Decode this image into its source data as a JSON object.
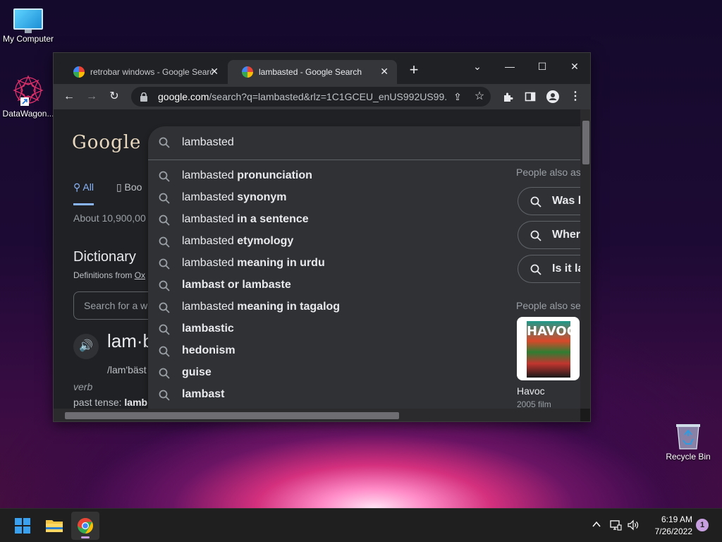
{
  "desktop": {
    "icons": [
      {
        "label": "My Computer"
      },
      {
        "label": "DataWagon..."
      },
      {
        "label": "Recycle Bin"
      }
    ]
  },
  "browser": {
    "tabs": [
      {
        "title": "retrobar windows - Google Search",
        "active": false
      },
      {
        "title": "lambasted - Google Search",
        "active": true
      }
    ],
    "url_host": "google.com",
    "url_rest": "/search?q=lambasted&rlz=1C1GCEU_enUS992US99..."
  },
  "search": {
    "query": "lambasted",
    "suggestions": [
      {
        "prefix": "lambasted ",
        "bold": "pronunciation"
      },
      {
        "prefix": "lambasted ",
        "bold": "synonym"
      },
      {
        "prefix": "lambasted ",
        "bold": "in a sentence"
      },
      {
        "prefix": "lambasted ",
        "bold": "etymology"
      },
      {
        "prefix": "lambasted ",
        "bold": "meaning in urdu"
      },
      {
        "prefix": "",
        "bold": "lambast or lambaste"
      },
      {
        "prefix": "lambasted ",
        "bold": "meaning in tagalog"
      },
      {
        "prefix": "",
        "bold": "lambastic"
      },
      {
        "prefix": "",
        "bold": "hedonism"
      },
      {
        "prefix": "",
        "bold": "guise"
      },
      {
        "prefix": "",
        "bold": "lambast"
      }
    ],
    "people_also_ask_heading": "People also as",
    "people_also_ask": [
      "Was l",
      "Where",
      "Is it la"
    ],
    "people_also_search_heading": "People also se",
    "movie": {
      "title": "Havoc",
      "year": "2005 film",
      "poster_word": "HAVOC"
    }
  },
  "page": {
    "logo": "Google",
    "nav_all": "All",
    "nav_books": "Boo",
    "stats": "About 10,900,00",
    "dictionary_title": "Dictionary",
    "definitions_from": "Definitions from ",
    "definitions_source": "Ox",
    "dict_search_placeholder": "Search for a w",
    "headword": "lam·b",
    "pronunciation": "/lam'bäst",
    "part_of_speech": "verb",
    "past_tense_label": "past tense: ",
    "past_tense_value": "lamb"
  },
  "taskbar": {
    "time": "6:19 AM",
    "date": "7/26/2022",
    "notifications": "1"
  },
  "colors": {
    "accent_blue": "#8ab4f8",
    "page_bg": "#202124",
    "dropdown_bg": "#303134",
    "toolbar_bg": "#35363a",
    "taskbar_bg": "#1f1f1f"
  }
}
